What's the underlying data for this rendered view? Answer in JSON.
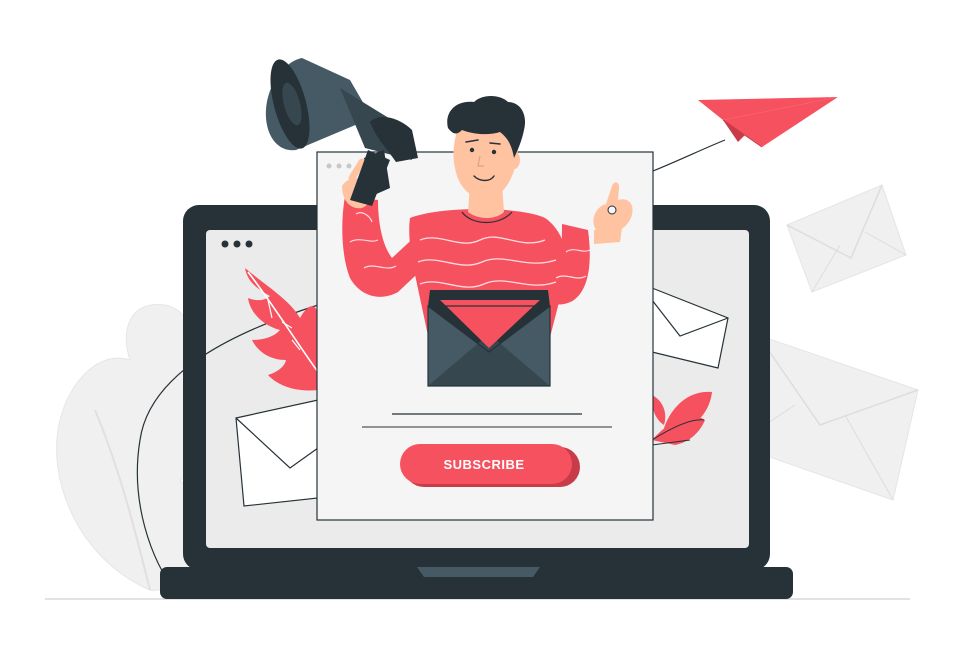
{
  "subscribe_card": {
    "button_label": "SUBSCRIBE"
  },
  "colors": {
    "accent": "#f5515f",
    "accent_dark": "#d8434f",
    "laptop": "#263238",
    "envelope_inner": "#455a64",
    "screen": "#ebebeb",
    "card": "#f5f5f5",
    "skin": "#ffc3a1",
    "hair": "#263238",
    "background_shapes": "#f0f0f0"
  },
  "icons": {
    "megaphone": "megaphone-icon",
    "paper_plane": "paper-plane-icon",
    "envelope": "envelope-icon",
    "leaf": "leaf-icon"
  }
}
